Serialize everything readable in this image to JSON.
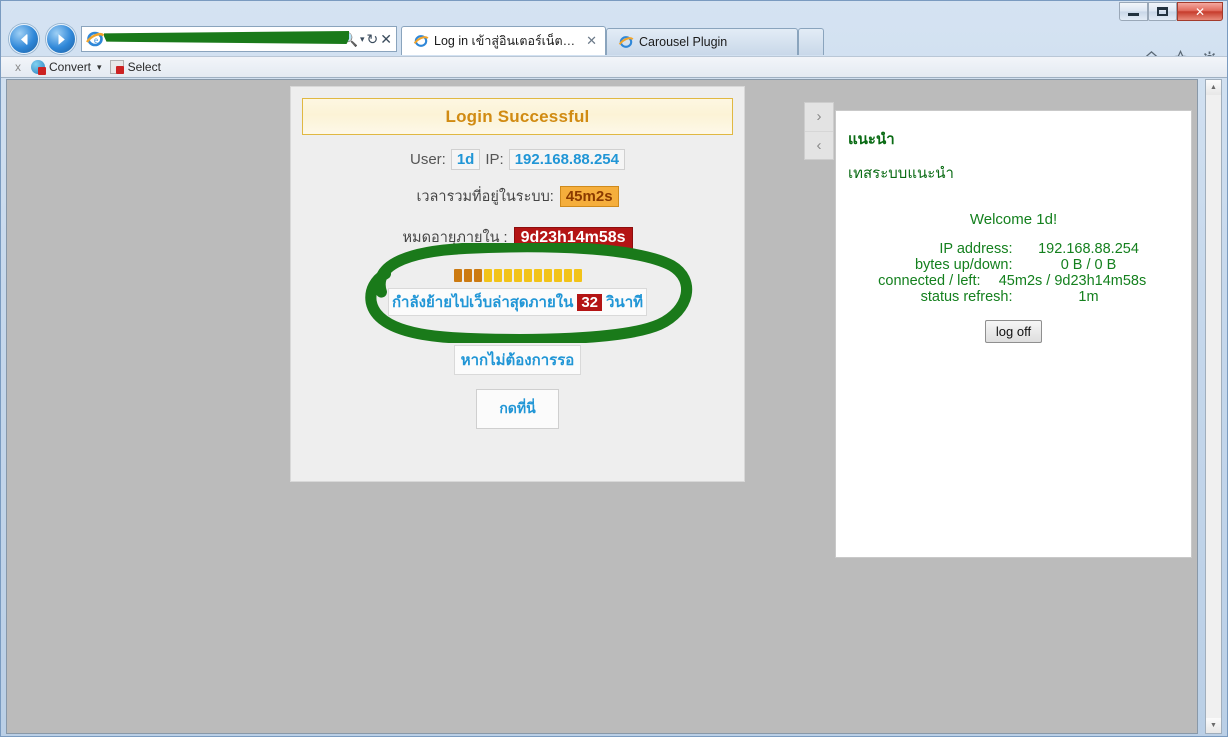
{
  "browser": {
    "window_controls": {
      "minimize": "minimize",
      "maximize": "maximize",
      "close": "✕"
    },
    "nav": {
      "back": "back",
      "forward": "forward"
    },
    "address": {
      "value": "",
      "redacted": true,
      "search_icon": "search-icon",
      "dropdown_icon": "▾",
      "refresh_icon": "↻",
      "stop_icon": "✕"
    },
    "tabs": [
      {
        "label": "Log in เข้าสู่อินเตอร์เน็ต Wi-Fi",
        "active": true,
        "close": "✕"
      },
      {
        "label": "Carousel Plugin",
        "active": false,
        "close": ""
      }
    ],
    "chrome_icons": [
      "home-icon",
      "favorites-star-icon",
      "settings-gear-icon"
    ],
    "addon_toolbar": {
      "close_label": "x",
      "convert_label": "Convert",
      "convert_caret": "▾",
      "select_label": "Select"
    }
  },
  "login_panel": {
    "banner_title": "Login Successful",
    "user_label": "User:",
    "user_value": "1d",
    "ip_label": "IP:",
    "ip_value": "192.168.88.254",
    "uptime_label": "เวลารวมที่อยู่ในระบบ:",
    "uptime_value": "45m2s",
    "expire_label": "หมดอายุภายใน :",
    "expire_value": "9d23h14m58s",
    "progress_total": 13,
    "progress_filled": 3,
    "progress_color_filled": "#cc7a11",
    "progress_color_empty": "#f2c318",
    "redirect_prefix": "กำลังย้ายไปเว็บล่าสุดภายใน",
    "redirect_seconds": "32",
    "redirect_suffix": "วินาที",
    "no_wait_label": "หากไม่ต้องการรอ",
    "click_here_label": "กดที่นี่"
  },
  "side_nav": {
    "next_icon": "›",
    "prev_icon": "‹"
  },
  "side_panel": {
    "heading": "แนะนำ",
    "subheading": "เทสระบบแนะนำ",
    "welcome": "Welcome 1d!",
    "stats": [
      {
        "label": "IP address:",
        "value": "192.168.88.254"
      },
      {
        "label": "bytes up/down:",
        "value": "0 B / 0 B"
      },
      {
        "label": "connected / left:",
        "value": "45m2s / 9d23h14m58s"
      },
      {
        "label": "status refresh:",
        "value": "1m"
      }
    ],
    "logoff_label": "log off"
  },
  "annotation": {
    "type": "hand-drawn-ellipse",
    "color": "#1a7a1a",
    "highlight_color": "#1a7a1a"
  },
  "scrollbar": {
    "up_icon": "▲",
    "down_icon": "▼"
  },
  "colors": {
    "page_background": "#bbbbbb",
    "panel_background": "#eeeeee",
    "banner_text": "#d18b12",
    "accent_blue": "#2196d6",
    "accent_red": "#b41414",
    "accent_orange": "#f5ae3c",
    "sidebar_green": "#0a6b14"
  }
}
